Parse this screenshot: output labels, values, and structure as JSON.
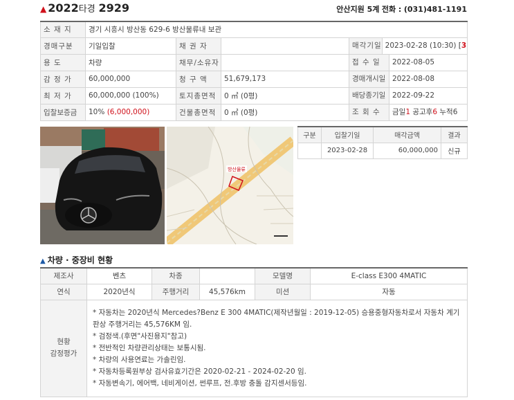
{
  "header": {
    "year": "2022",
    "case_type": "타경",
    "case_num": "2929",
    "court": "안산지원 5계",
    "phone_label": "전화 :",
    "phone": "(031)481-1191"
  },
  "info": {
    "location_label": "소 재 지",
    "location": "경기 시흥시 방산동 629-6 방산물류내 보관",
    "auction_type_label": "경매구분",
    "auction_type": "기일입찰",
    "creditor_label": "채 권 자",
    "creditor": "",
    "sale_date_label": "매각기일",
    "sale_date": "2023-02-28 (10:30)",
    "sale_date_bracket_open": " [",
    "sale_date_days": "3",
    "sale_date_days_suffix": "일전",
    "sale_date_bracket_close": "]",
    "usage_label": "용    도",
    "usage": "차량",
    "debtor_label": "채무/소유자",
    "debtor": "",
    "received_label": "접 수 일",
    "received": "2022-08-05",
    "appraisal_label": "감 정 가",
    "appraisal": "60,000,000",
    "claim_label": "청 구 액",
    "claim": "51,679,173",
    "start_label": "경매개시일",
    "start": "2022-08-08",
    "min_label": "최 저 가",
    "min": "60,000,000 (100%)",
    "land_label": "토지총면적",
    "land": "0 ㎡ (0평)",
    "dividend_label": "배당종기일",
    "dividend": "2022-09-22",
    "deposit_label": "입찰보증금",
    "deposit_pct": "10%",
    "deposit_amt": "(6,000,000)",
    "building_label": "건물총면적",
    "building": "0 ㎡ (0평)",
    "views_label": "조 회 수",
    "views_today_label": "금일",
    "views_today": "1",
    "views_notice_label": "공고후",
    "views_notice": "6",
    "views_total_label": "누적",
    "views_total": "6"
  },
  "map_label": "방산물류",
  "history": {
    "headers": [
      "구분",
      "입찰기일",
      "매각금액",
      "결과"
    ],
    "rows": [
      {
        "gubun": "",
        "date": "2023-02-28",
        "amount": "60,000,000",
        "result": "신규"
      }
    ]
  },
  "section_title": "차량 · 중장비 현황",
  "vehicle": {
    "maker_label": "제조사",
    "maker": "벤츠",
    "model_type_label": "차종",
    "model_type": "",
    "model_name_label": "모델명",
    "model_name": "E-class E300 4MATIC",
    "year_label": "연식",
    "year": "2020년식",
    "mileage_label": "주행거리",
    "mileage": "45,576km",
    "transmission_label": "미션",
    "transmission": "자동",
    "status_label_1": "현황",
    "status_label_2": "감정평가",
    "status_lines": [
      "* 자동차는 2020년식 Mercedes?Benz E 300 4MATIC(제작년월일 : 2019-12-05) 승용중형자동차로서 자동차 계기판상 주행거리는 45,576KM 임.",
      "* 검정색.(후면\"사진용지\"참고)",
      "* 전반적인 차량관리상태는 보통시됨.",
      "* 차량의 사용연료는 가솔린임.",
      "* 자동차등록원부상 검사유효기간은 2020-02-21 - 2024-02-20 임.",
      "* 자동변속기, 에어백, 네비게이션, 썬루프, 전.후방 충돌 감지센서등임."
    ]
  },
  "colors": {
    "accent_red": "#d0111b",
    "section_blue": "#1e5aa6",
    "label_bg": "#f3f3f3"
  }
}
